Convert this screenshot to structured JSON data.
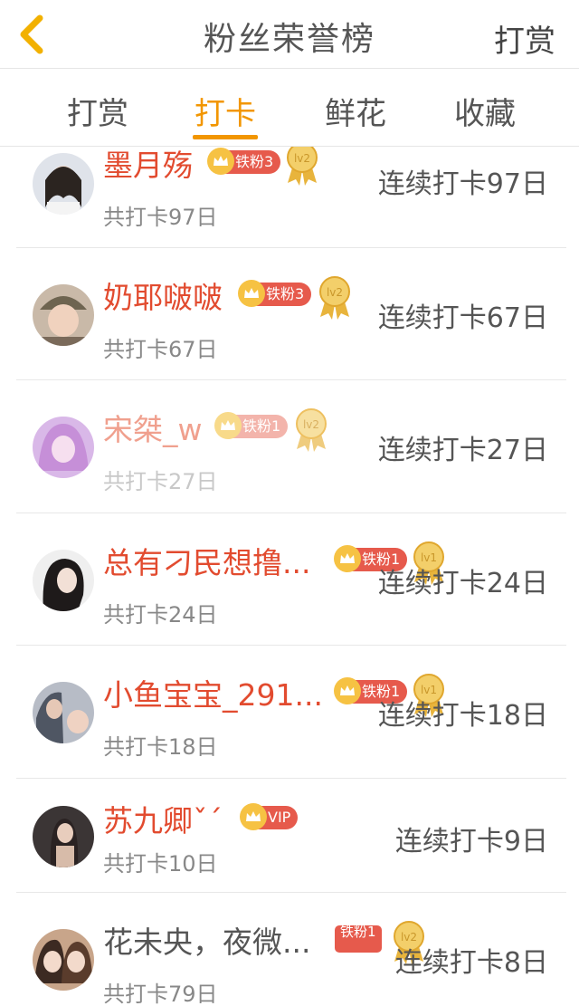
{
  "header": {
    "title": "粉丝荣誉榜",
    "action_label": "打赏"
  },
  "tabs": [
    {
      "label": "打赏",
      "active": false
    },
    {
      "label": "打卡",
      "active": true
    },
    {
      "label": "鲜花",
      "active": false
    },
    {
      "label": "收藏",
      "active": false
    }
  ],
  "colors": {
    "accent": "#f29600",
    "name_red": "#e24b2f",
    "badge_red": "#e65a4c",
    "medal_gold": "#e8b43c"
  },
  "fans": [
    {
      "name": "墨月殇",
      "fan_badge": "铁粉3",
      "level": "lv2",
      "total": "共打卡97日",
      "streak": "连续打卡97日"
    },
    {
      "name": "奶耶啵啵",
      "fan_badge": "铁粉3",
      "level": "lv2",
      "total": "共打卡67日",
      "streak": "连续打卡67日"
    },
    {
      "name": "宋桀_w",
      "fan_badge": "铁粉1",
      "level": "lv2",
      "total": "共打卡27日",
      "streak": "连续打卡27日"
    },
    {
      "name": "总有刁民想撸...",
      "fan_badge": "铁粉1",
      "level": "lv1",
      "total": "共打卡24日",
      "streak": "连续打卡24日"
    },
    {
      "name": "小鱼宝宝_291...",
      "fan_badge": "铁粉1",
      "level": "lv1",
      "total": "共打卡18日",
      "streak": "连续打卡18日"
    },
    {
      "name": "苏九卿ˇˊ",
      "fan_badge": "VIP",
      "level": "",
      "total": "共打卡10日",
      "streak": "连续打卡9日"
    },
    {
      "name": "花未央，夜微...",
      "fan_badge": "铁粉1",
      "level": "lv2",
      "total": "共打卡79日",
      "streak": "连续打卡8日"
    }
  ]
}
